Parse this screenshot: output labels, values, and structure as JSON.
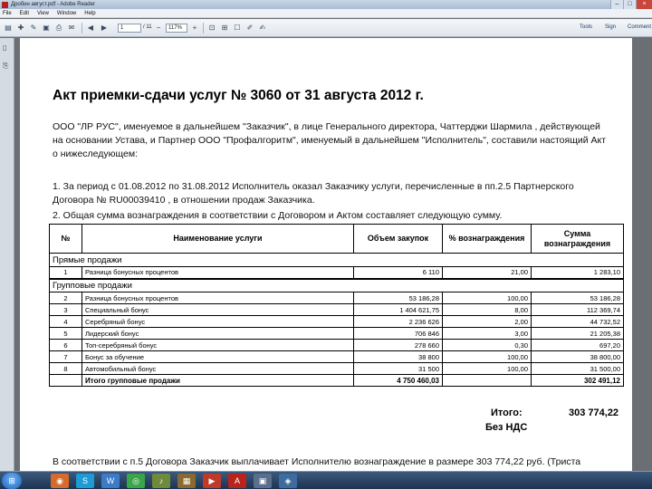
{
  "window": {
    "title": "Дробин август.pdf - Adobe Reader",
    "controls": [
      "–",
      "□",
      "×"
    ]
  },
  "menu": [
    "File",
    "Edit",
    "View",
    "Window",
    "Help"
  ],
  "toolbar": {
    "page_current": "1",
    "page_total": "/ 11",
    "zoom": "117%",
    "links": [
      "Tools",
      "Sign",
      "Comment"
    ]
  },
  "document": {
    "title": "Акт приемки-сдачи услуг № 3060 от 31 августа 2012 г.",
    "intro_lines": [
      "ООО \"ЛР РУС\", именуемое в дальнейшем \"Заказчик\", в лице Генерального директора, Чаттерджи  Шармила , действующей",
      "на основании Устава, и Партнер ООО \"Профалгоритм\", именуемый в дальнейшем \"Исполнитель\", составили настоящий Акт",
      "о нижеследующем:"
    ],
    "point1_lines": [
      "1. За период с 01.08.2012 по 31.08.2012 Исполнитель оказал Заказчику услуги, перечисленные в пп.2.5 Партнерского",
      "Договора № RU00039410 , в отношении продаж Заказчика."
    ],
    "point2": "2. Общая сумма вознаграждения в соответствии с Договором и Актом составляет следующую сумму.",
    "table": {
      "headers": [
        "№",
        "Наименование услуги",
        "Объем закупок",
        "% вознаграждения",
        "Сумма вознаграждения"
      ],
      "group_direct": "Прямые продажи",
      "direct_rows": [
        {
          "n": "1",
          "name": "Разница бонусных процентов",
          "volume": "6 110",
          "percent": "21,00",
          "amount": "1 283,10"
        }
      ],
      "group_group": "Групповые продажи",
      "group_rows": [
        {
          "n": "2",
          "name": "Разница бонусных процентов",
          "volume": "53 186,28",
          "percent": "100,00",
          "amount": "53 186,28"
        },
        {
          "n": "3",
          "name": "Специальный бонус",
          "volume": "1 404 621,75",
          "percent": "8,00",
          "amount": "112 369,74"
        },
        {
          "n": "4",
          "name": "Серебряный бонус",
          "volume": "2 236 626",
          "percent": "2,00",
          "amount": "44 732,52"
        },
        {
          "n": "5",
          "name": "Лидерский бонус",
          "volume": "706 846",
          "percent": "3,00",
          "amount": "21 205,38"
        },
        {
          "n": "6",
          "name": "Топ-серебряный бонус",
          "volume": "278 660",
          "percent": "0,30",
          "amount": "697,20"
        },
        {
          "n": "7",
          "name": "Бонус за обучение",
          "volume": "38 800",
          "percent": "100,00",
          "amount": "38 800,00"
        },
        {
          "n": "8",
          "name": "Автомобильный бонус",
          "volume": "31 500",
          "percent": "100,00",
          "amount": "31 500,00"
        }
      ],
      "group_total": {
        "label": "Итого групповые продажи",
        "volume": "4 750 460,03",
        "amount": "302 491,12"
      }
    },
    "total_label": "Итого:",
    "total_value": "303 774,22",
    "vat_label": "Без НДС",
    "footer_line": "В соответствии с п.5 Договора Заказчик выплачивает Исполнителю вознаграждение в размере  303 774,22 руб. (Триста"
  }
}
